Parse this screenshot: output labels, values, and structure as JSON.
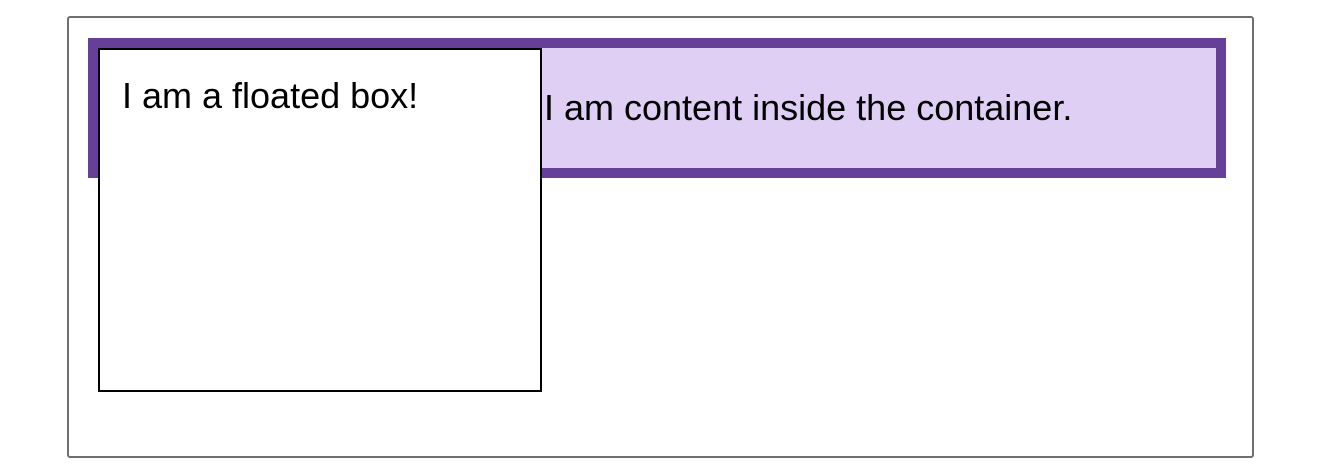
{
  "colors": {
    "container_border": "#663f99",
    "container_background": "#dfcff4",
    "frame_border": "#6f6f6f",
    "float_border": "#000000",
    "float_background": "#ffffff"
  },
  "container": {
    "text": "I am content inside the container."
  },
  "float_box": {
    "text": "I am a floated box!"
  }
}
